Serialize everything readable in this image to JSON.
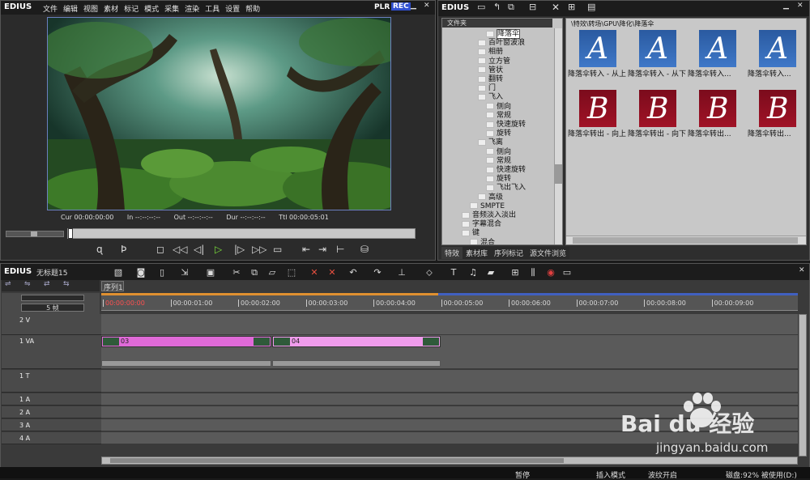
{
  "player": {
    "logo": "EDIUS",
    "menu": [
      "文件",
      "编辑",
      "视图",
      "素材",
      "标记",
      "模式",
      "采集",
      "渲染",
      "工具",
      "设置",
      "帮助"
    ],
    "plr": "PLR",
    "rec": "REC",
    "cur_label": "Cur",
    "cur": "00:00:00:00",
    "in_label": "In",
    "in": "--:--:--:--",
    "out_label": "Out",
    "out": "--:--:--:--",
    "dur_label": "Dur",
    "dur": "--:--:--:--",
    "ttl_label": "Ttl",
    "ttl": "00:00:05:01"
  },
  "bin": {
    "logo": "EDIUS",
    "tree_header": "文件夹",
    "path": "\\特效\\转场\\GPU\\降化\\降落伞",
    "tree": [
      "降落伞",
      "百叶窗波浪",
      "相册",
      "立方管",
      "管状",
      "翻转",
      "门",
      "飞入",
      "侧向",
      "常规",
      "快速旋转",
      "旋转",
      "飞离",
      "侧向",
      "常规",
      "快速旋转",
      "旋转",
      "飞出飞入",
      "高级",
      "SMPTE",
      "音频淡入淡出",
      "字幕混合",
      "键",
      "混合"
    ],
    "tabs": [
      "特效",
      "素材库",
      "序列标记",
      "源文件浏览"
    ],
    "thumbs": [
      {
        "letter": "A",
        "caption": "降落伞转入 - 从上"
      },
      {
        "letter": "A",
        "caption": "降落伞转入 - 从下"
      },
      {
        "letter": "A",
        "caption": "降落伞转入..."
      },
      {
        "letter": "A",
        "caption": "降落伞转入..."
      },
      {
        "letter": "B",
        "caption": "降落伞转出 - 向上"
      },
      {
        "letter": "B",
        "caption": "降落伞转出 - 向下"
      },
      {
        "letter": "B",
        "caption": "降落伞转出..."
      },
      {
        "letter": "B",
        "caption": "降落伞转出..."
      }
    ]
  },
  "timeline": {
    "logo": "EDIUS",
    "project": "无标题15",
    "seq_tab": "序列1",
    "zoom": "5 帧",
    "ruler": [
      "00:00:00:00",
      "00:00:01:00",
      "00:00:02:00",
      "00:00:03:00",
      "00:00:04:00",
      "00:00:05:00",
      "00:00:06:00",
      "00:00:07:00",
      "00:00:08:00",
      "00:00:09:00"
    ],
    "tracks": [
      "2 V",
      "1 VA",
      "1 T",
      "1 A",
      "2 A",
      "3 A",
      "4 A"
    ],
    "clips": [
      {
        "label": "03"
      },
      {
        "label": "04"
      }
    ]
  },
  "status": {
    "paused": "暂停",
    "insert": "插入模式",
    "ripple": "波纹开启",
    "disk": "磁盘:92% 被使用(D:)"
  },
  "watermark": {
    "brand": "Bai du 经验",
    "url": "jingyan.baidu.com"
  },
  "colors": {
    "clip_pink": "#e06ad8",
    "clip_pink_light": "#f09cec",
    "rec_blue": "#3050d0"
  }
}
